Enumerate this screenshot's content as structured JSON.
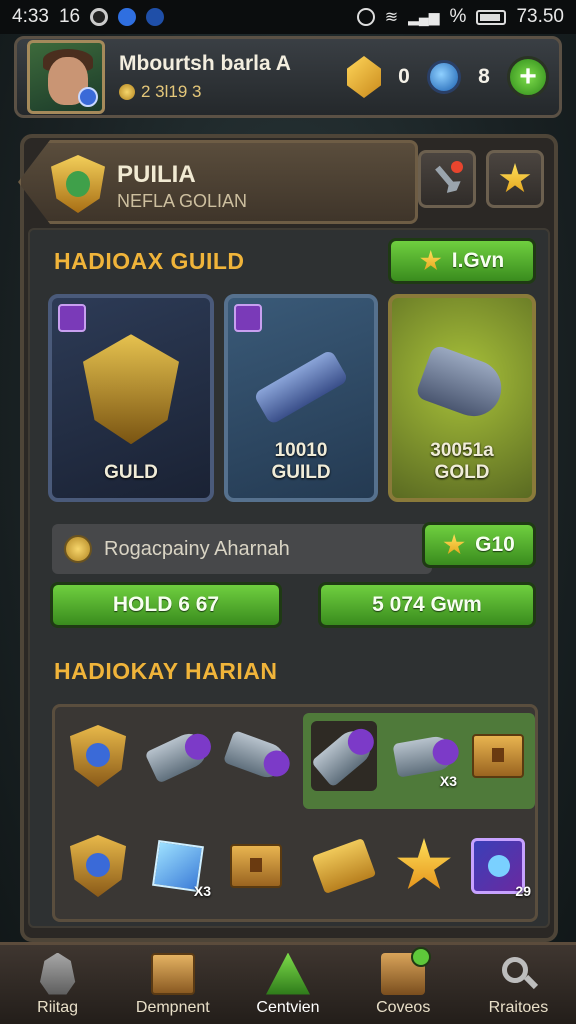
{
  "status_bar": {
    "time": "4:33",
    "carrier": "16",
    "battery_pct": "%",
    "clock_right": "73.50"
  },
  "profile": {
    "name": "Mbourtsh barla A",
    "level": "2 3l19 3",
    "gold_amount": "0",
    "orb_amount": "8",
    "plus_label": "+"
  },
  "guild_header": {
    "title": "PUILIA",
    "subtitle": "NEFLA GOLIAN"
  },
  "section1": {
    "title": "HADIOAX GUILD",
    "button_label": "I.Gvn",
    "cards": [
      {
        "label": "GULD",
        "accent": "#3a4c66"
      },
      {
        "label": "10010\nGUILD",
        "accent": "#2f4a63"
      },
      {
        "label": "30051a\nGOLD",
        "accent": "#6b7a2a"
      }
    ],
    "info_text": "Rogacpainy Aharnah",
    "info_button": "G10",
    "action_left": "HOLD 6 67",
    "action_right": "5 074 Gwm"
  },
  "section2": {
    "title": "HADIOKAY HARIAN",
    "items": [
      {
        "icon": "shield-icon",
        "count": ""
      },
      {
        "icon": "cannon-icon",
        "count": ""
      },
      {
        "icon": "cannon-icon",
        "count": ""
      },
      {
        "icon": "cannon-icon",
        "count": ""
      },
      {
        "icon": "cannon-icon",
        "count": "X3"
      },
      {
        "icon": "chest-icon",
        "count": ""
      },
      {
        "icon": "shield-icon",
        "count": ""
      },
      {
        "icon": "cube-icon",
        "count": "X3"
      },
      {
        "icon": "chest-icon",
        "count": ""
      },
      {
        "icon": "ticket-icon",
        "count": ""
      },
      {
        "icon": "star-icon",
        "count": ""
      },
      {
        "icon": "card-icon",
        "count": "29"
      }
    ]
  },
  "bottom_nav": [
    {
      "label": "Riitag",
      "icon": "helmet-icon"
    },
    {
      "label": "Dempnent",
      "icon": "chest-icon"
    },
    {
      "label": "Centvien",
      "icon": "triangle-icon"
    },
    {
      "label": "Coveos",
      "icon": "box-icon"
    },
    {
      "label": "Rraitoes",
      "icon": "search-icon"
    }
  ],
  "colors": {
    "accent_gold": "#f0b43a",
    "button_green": "#4ea82a",
    "panel_brown": "#4e4538"
  }
}
